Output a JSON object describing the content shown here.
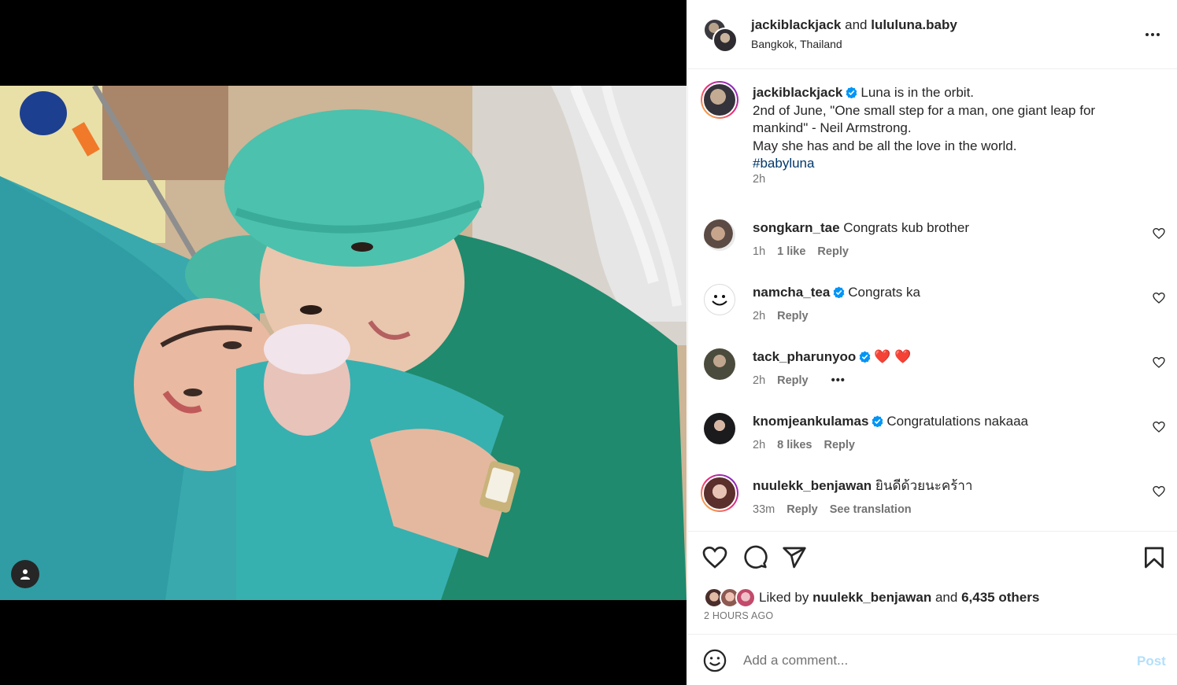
{
  "header": {
    "user1": "jackiblackjack",
    "joiner": "and",
    "user2": "lululuna.baby",
    "location": "Bangkok, Thailand"
  },
  "caption": {
    "username": "jackiblackjack",
    "lines": [
      "Luna is in the orbit.",
      "2nd of June, \"One small step for a man, one giant leap for mankind\" - Neil Armstrong.",
      "May she has and be all the love in the world."
    ],
    "hashtag": "#babyluna",
    "time": "2h"
  },
  "comments": [
    {
      "username": "songkarn_tae",
      "verified": false,
      "text": "Congrats kub brother",
      "time": "1h",
      "likes": "1 like",
      "reply": "Reply"
    },
    {
      "username": "namcha_tea",
      "verified": true,
      "text": "Congrats ka",
      "time": "2h",
      "reply": "Reply"
    },
    {
      "username": "tack_pharunyoo",
      "verified": true,
      "text": "❤️ ❤️",
      "time": "2h",
      "reply": "Reply",
      "more": "•••"
    },
    {
      "username": "knomjeankulamas",
      "verified": true,
      "text": "Congratulations nakaaa",
      "time": "2h",
      "likes": "8 likes",
      "reply": "Reply"
    },
    {
      "username": "nuulekk_benjawan",
      "verified": false,
      "text": "ยินดีด้วยนะคร้าา",
      "time": "33m",
      "reply": "Reply",
      "translate": "See translation"
    }
  ],
  "likes": {
    "prefix": "Liked by",
    "user": "nuulekk_benjawan",
    "joiner": "and",
    "others": "6,435 others"
  },
  "post_time": "2 HOURS AGO",
  "add_comment": {
    "placeholder": "Add a comment...",
    "post_label": "Post"
  },
  "colors": {
    "verified": "#0095f6",
    "hashtag": "#00376b",
    "post_disabled": "#b2dffc",
    "heart_red": "#ff3040"
  }
}
